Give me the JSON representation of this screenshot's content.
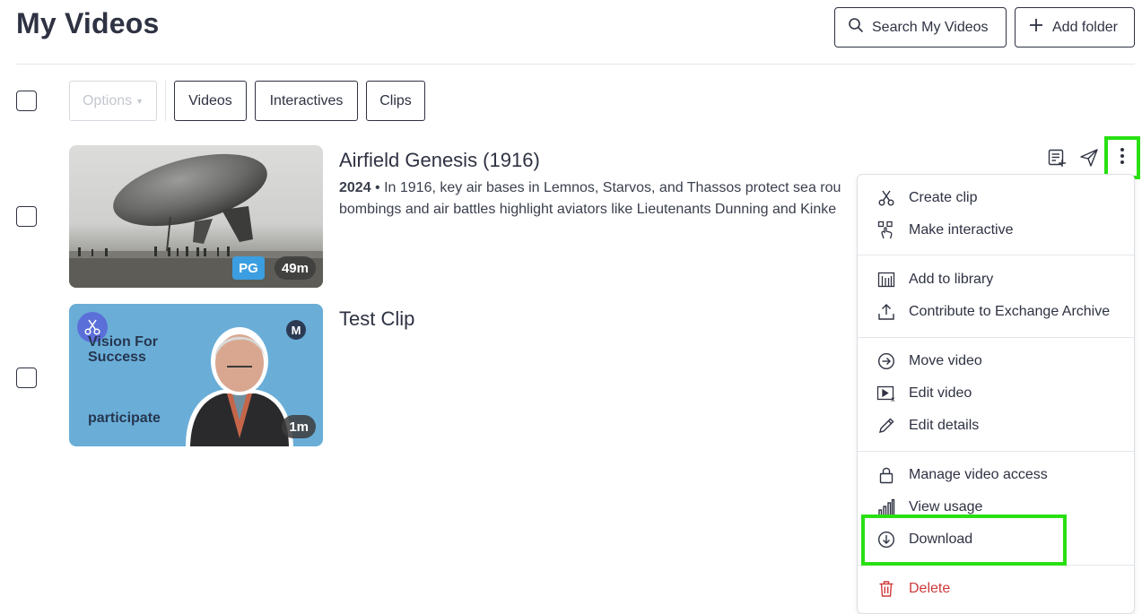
{
  "header": {
    "title": "My Videos",
    "search_label": "Search My Videos",
    "add_folder_label": "Add folder"
  },
  "toolbar": {
    "options_label": "Options",
    "filters": [
      "Videos",
      "Interactives",
      "Clips"
    ]
  },
  "videos": [
    {
      "title": "Airfield Genesis (1916)",
      "year": "2024",
      "description": "In 1916, key air bases in Lemnos, Starvos, and Thassos protect sea rou",
      "description_line2": "bombings and air battles highlight aviators like Lieutenants Dunning and Kinke",
      "rating": "PG",
      "duration": "49m"
    },
    {
      "title": "Test Clip",
      "thumb_text_1": "Vision For",
      "thumb_text_2": "Success",
      "thumb_brand": "participate",
      "duration": "1m"
    }
  ],
  "context_menu": {
    "items": [
      {
        "label": "Create clip",
        "icon": "scissors-icon"
      },
      {
        "label": "Make interactive",
        "icon": "touch-icon"
      },
      {
        "label": "Add to library",
        "icon": "library-icon"
      },
      {
        "label": "Contribute to Exchange Archive",
        "icon": "upload-icon"
      },
      {
        "label": "Move video",
        "icon": "arrow-circle-icon"
      },
      {
        "label": "Edit video",
        "icon": "video-edit-icon"
      },
      {
        "label": "Edit details",
        "icon": "pencil-icon"
      },
      {
        "label": "Manage video access",
        "icon": "lock-icon"
      },
      {
        "label": "View usage",
        "icon": "bar-chart-icon"
      },
      {
        "label": "Download",
        "icon": "download-icon"
      },
      {
        "label": "Delete",
        "icon": "trash-icon"
      }
    ]
  },
  "colors": {
    "highlight": "#29e012",
    "danger": "#cf3a3a",
    "pg_badge": "#3b9ee0",
    "text": "#2e3242"
  }
}
